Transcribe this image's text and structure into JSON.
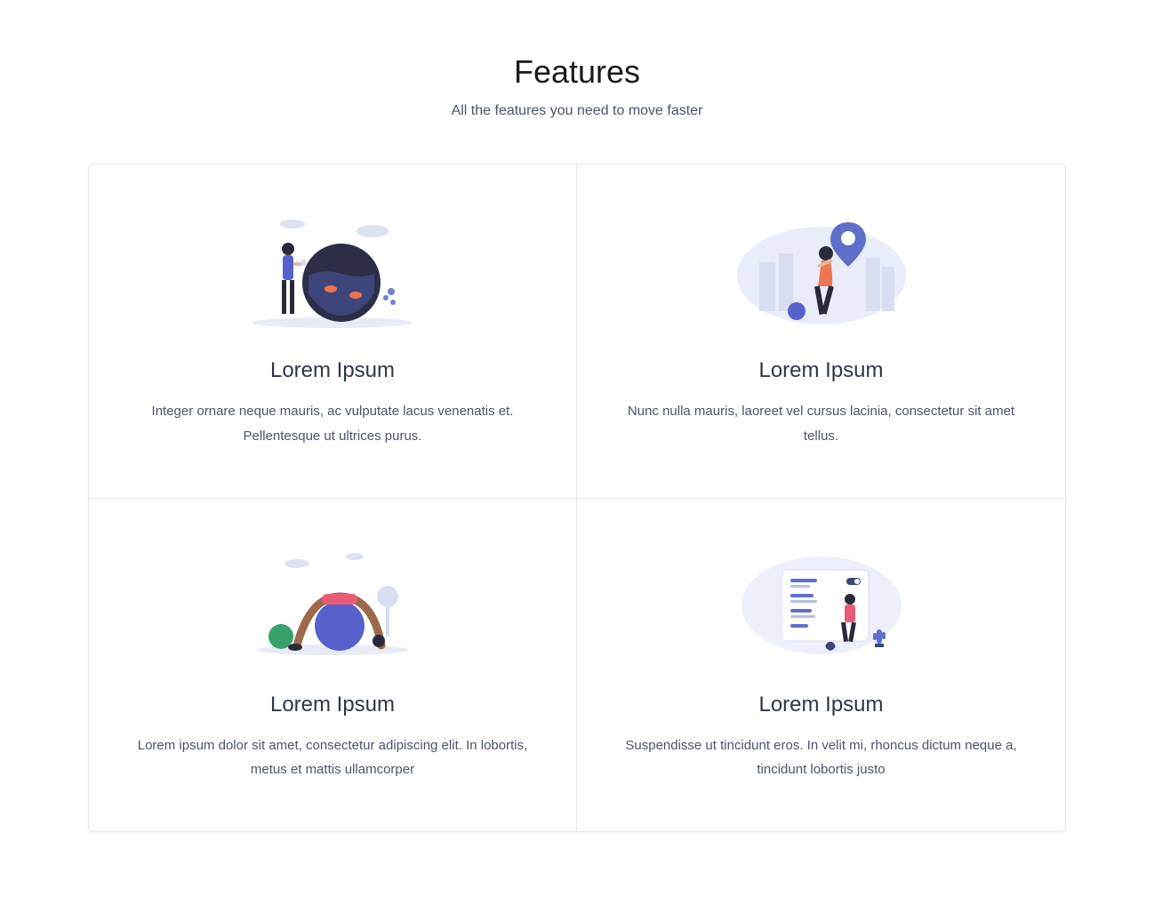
{
  "header": {
    "title": "Features",
    "subtitle": "All the features you need to move faster"
  },
  "cards": [
    {
      "title": "Lorem Ipsum",
      "description": "Integer ornare neque mauris, ac vulputate lacus venenatis et. Pellentesque ut ultrices purus."
    },
    {
      "title": "Lorem Ipsum",
      "description": "Nunc nulla mauris, laoreet vel cursus lacinia, consectetur sit amet tellus."
    },
    {
      "title": "Lorem Ipsum",
      "description": "Lorem ipsum dolor sit amet, consectetur adipiscing elit. In lobortis, metus et mattis ullamcorper"
    },
    {
      "title": "Lorem Ipsum",
      "description": "Suspendisse ut tincidunt eros. In velit mi, rhoncus dictum neque a, tincidunt lobortis justo"
    }
  ]
}
